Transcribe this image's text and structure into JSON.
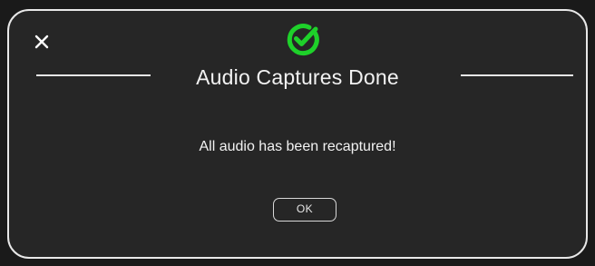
{
  "dialog": {
    "title": "Audio Captures Done",
    "message": "All audio has been recaptured!",
    "ok_label": "OK",
    "status_icon": "check-circle-icon",
    "close_icon": "close-icon"
  },
  "colors": {
    "dialog_background": "#262626",
    "dialog_border": "#e8e8e8",
    "success_green": "#1ed12a",
    "text": "#f2f2f2"
  }
}
